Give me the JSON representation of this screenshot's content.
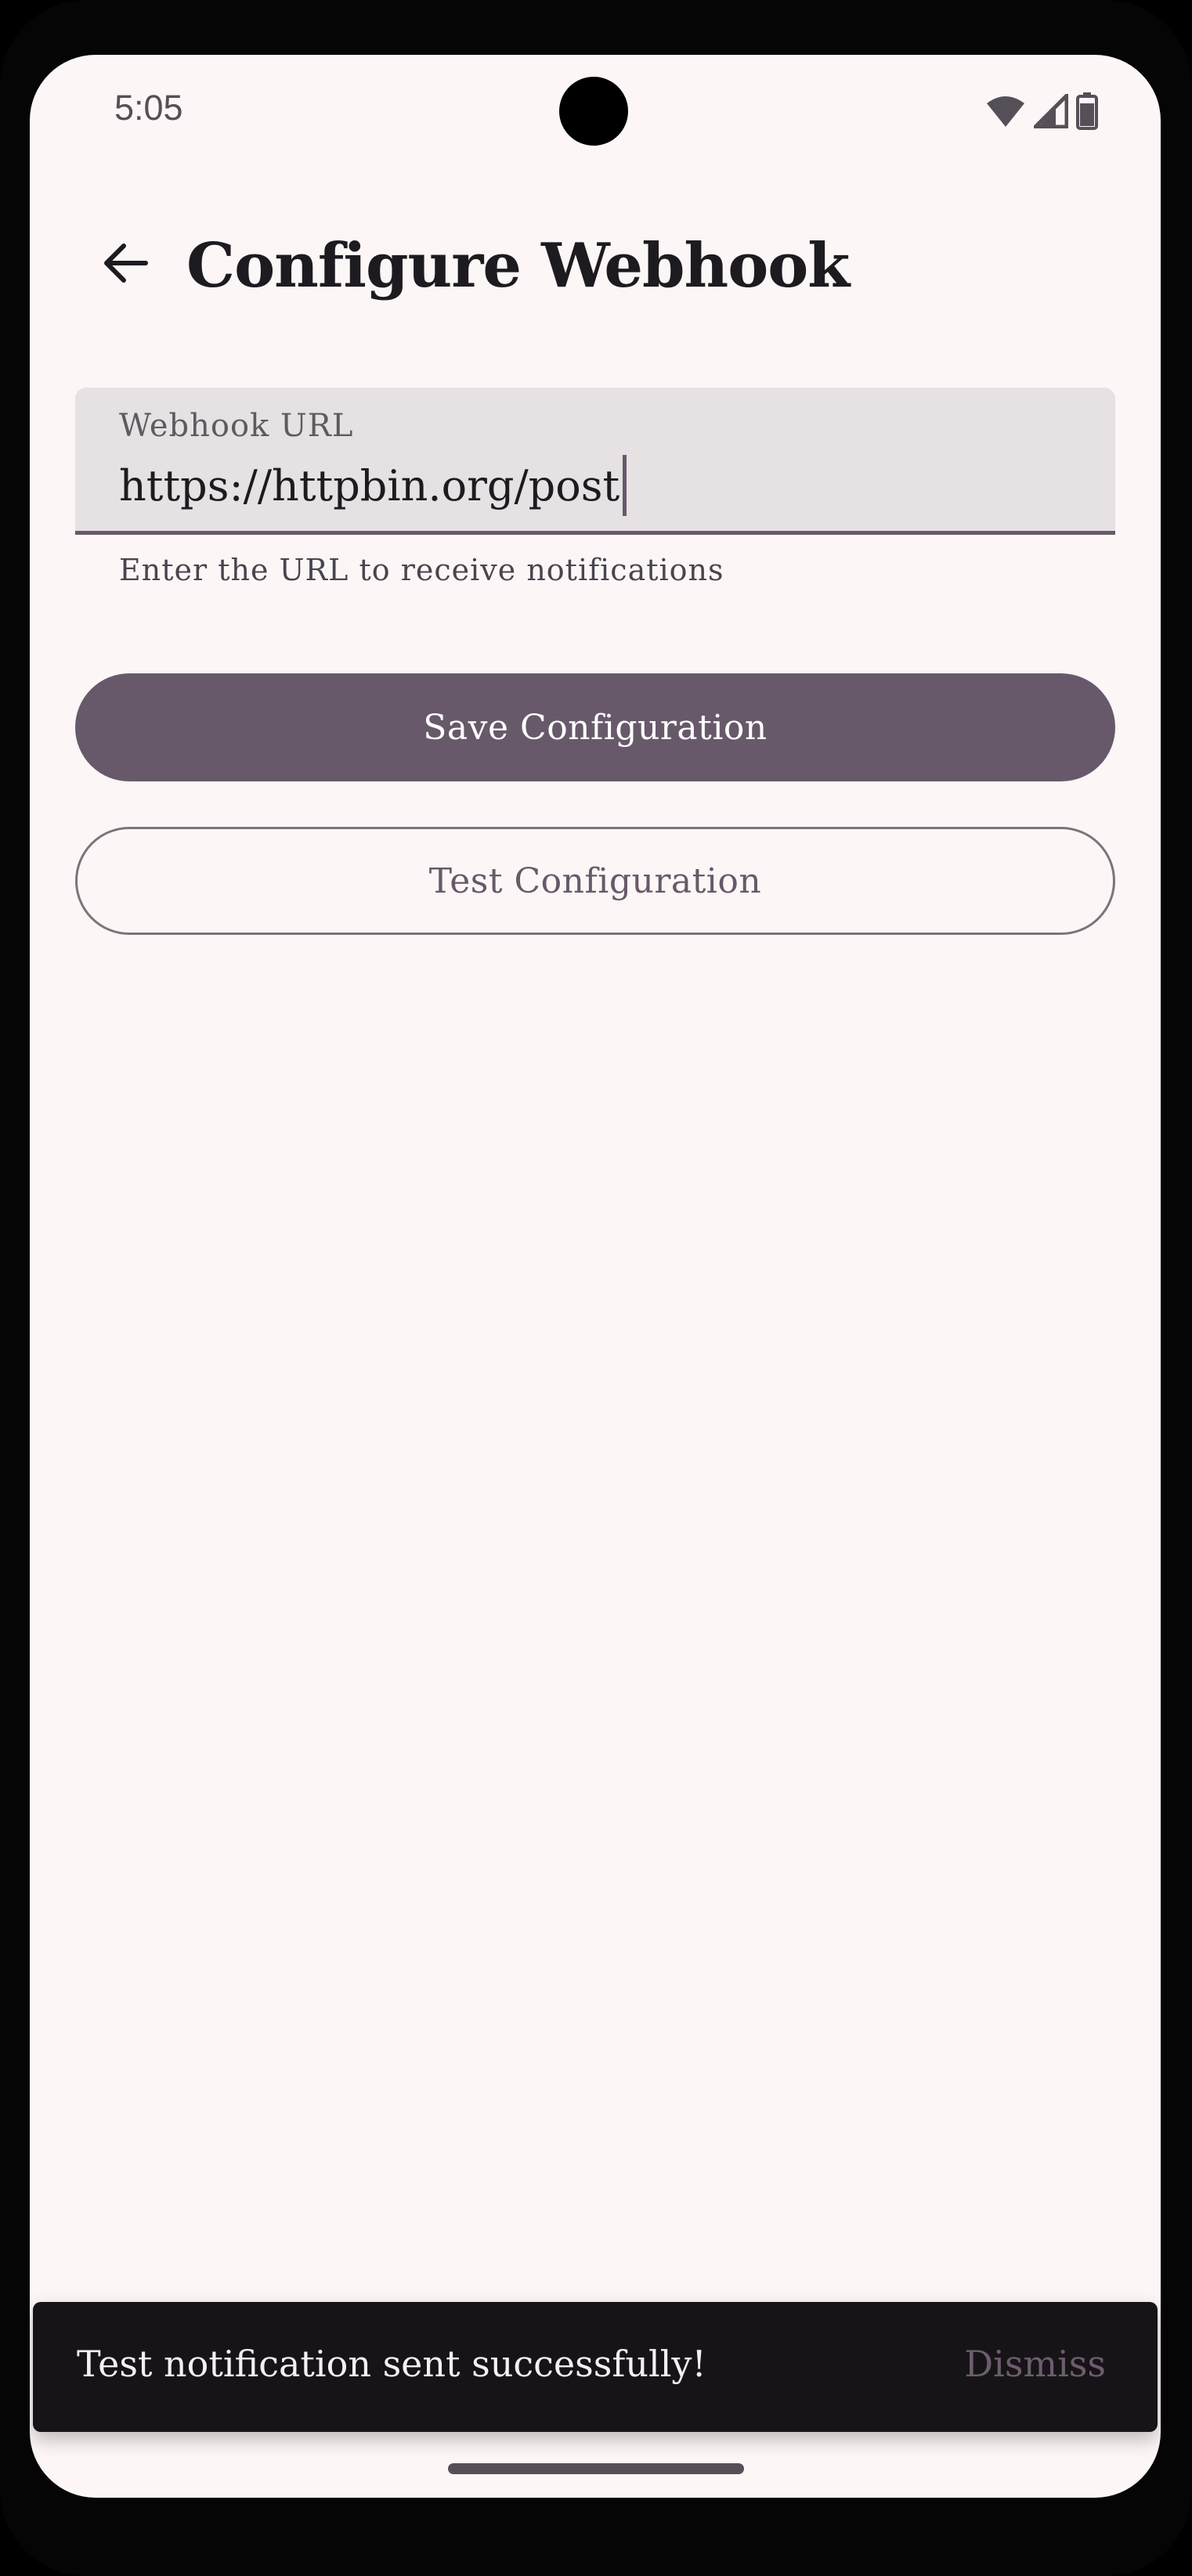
{
  "status_bar": {
    "time": "5:05",
    "icons": [
      "wifi-icon",
      "signal-icon",
      "battery-icon"
    ]
  },
  "app_bar": {
    "back_icon": "arrow-back-icon",
    "title": "Configure Webhook"
  },
  "webhook_field": {
    "label": "Webhook URL",
    "value": "https://httpbin.org/post",
    "helper": "Enter the URL to receive notifications"
  },
  "actions": {
    "save_label": "Save Configuration",
    "test_label": "Test Configuration"
  },
  "snackbar": {
    "message": "Test notification sent successfully!",
    "action": "Dismiss"
  },
  "colors": {
    "background": "#fcf7f6",
    "primary": "#67596a",
    "field_fill": "#e6e1e3",
    "snackbar_bg": "#171417",
    "snackbar_action": "#6c5d6e"
  }
}
